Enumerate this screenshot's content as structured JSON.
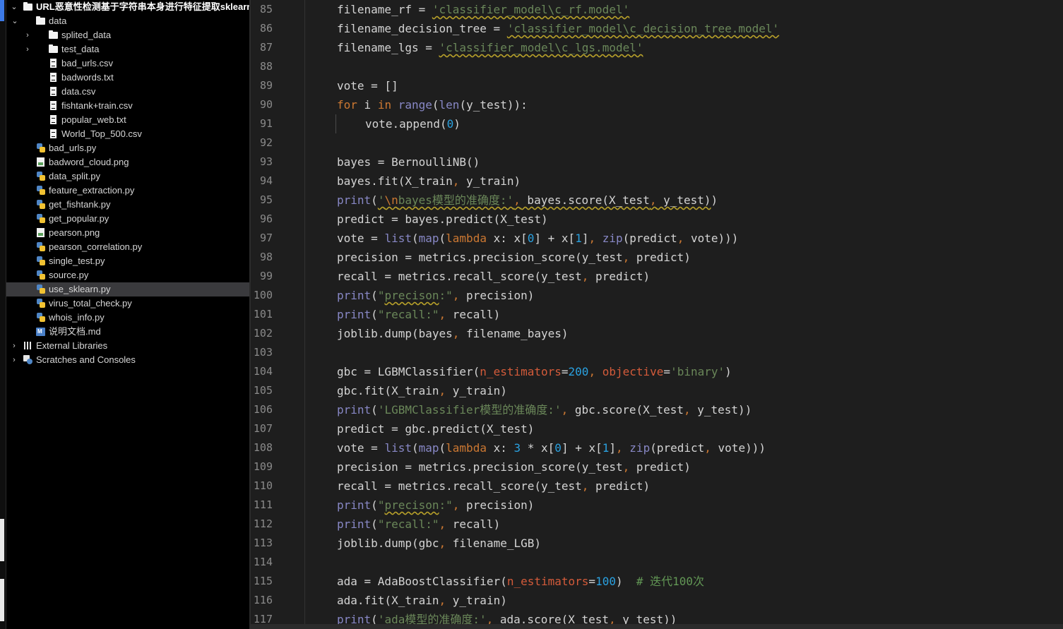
{
  "project_tree": {
    "root": "URL恶意性检测基于字符串本身进行特征提取sklearn库的",
    "items": [
      {
        "label": "data",
        "type": "folder",
        "depth": 1,
        "expanded": true
      },
      {
        "label": "splited_data",
        "type": "folder",
        "depth": 2,
        "expanded": false
      },
      {
        "label": "test_data",
        "type": "folder",
        "depth": 2,
        "expanded": false
      },
      {
        "label": "bad_urls.csv",
        "type": "file",
        "depth": 2
      },
      {
        "label": "badwords.txt",
        "type": "file",
        "depth": 2
      },
      {
        "label": "data.csv",
        "type": "file",
        "depth": 2
      },
      {
        "label": "fishtank+train.csv",
        "type": "file",
        "depth": 2
      },
      {
        "label": "popular_web.txt",
        "type": "file",
        "depth": 2
      },
      {
        "label": "World_Top_500.csv",
        "type": "file",
        "depth": 2
      },
      {
        "label": "bad_urls.py",
        "type": "python",
        "depth": 1
      },
      {
        "label": "badword_cloud.png",
        "type": "image",
        "depth": 1
      },
      {
        "label": "data_split.py",
        "type": "python",
        "depth": 1
      },
      {
        "label": "feature_extraction.py",
        "type": "python",
        "depth": 1
      },
      {
        "label": "get_fishtank.py",
        "type": "python",
        "depth": 1
      },
      {
        "label": "get_popular.py",
        "type": "python",
        "depth": 1
      },
      {
        "label": "pearson.png",
        "type": "image",
        "depth": 1
      },
      {
        "label": "pearson_correlation.py",
        "type": "python",
        "depth": 1
      },
      {
        "label": "single_test.py",
        "type": "python",
        "depth": 1
      },
      {
        "label": "source.py",
        "type": "python",
        "depth": 1
      },
      {
        "label": "use_sklearn.py",
        "type": "python",
        "depth": 1,
        "selected": true
      },
      {
        "label": "virus_total_check.py",
        "type": "python",
        "depth": 1
      },
      {
        "label": "whois_info.py",
        "type": "python",
        "depth": 1
      },
      {
        "label": "说明文档.md",
        "type": "markdown",
        "depth": 1
      }
    ],
    "external_libraries": "External Libraries",
    "scratches": "Scratches and Consoles"
  },
  "editor": {
    "lines": [
      {
        "n": "85",
        "t": [
          [
            "",
            "filename_rf = "
          ],
          [
            "s u",
            "'classifier_model\\c_rf.model'"
          ]
        ]
      },
      {
        "n": "86",
        "t": [
          [
            "",
            "filename_decision_tree = "
          ],
          [
            "s u",
            "'classifier_model\\c_decision_tree.model'"
          ]
        ]
      },
      {
        "n": "87",
        "t": [
          [
            "",
            "filename_lgs = "
          ],
          [
            "s u",
            "'classifier_model\\c_lgs.model'"
          ]
        ]
      },
      {
        "n": "88",
        "t": []
      },
      {
        "n": "89",
        "t": [
          [
            "",
            "vote = []"
          ]
        ]
      },
      {
        "n": "90",
        "t": [
          [
            "k",
            "for"
          ],
          [
            "",
            " i "
          ],
          [
            "k",
            "in"
          ],
          [
            "",
            " "
          ],
          [
            "b",
            "range"
          ],
          [
            "",
            "("
          ],
          [
            "b",
            "len"
          ],
          [
            "",
            "(y_test)):"
          ]
        ]
      },
      {
        "n": "91",
        "indent": true,
        "t": [
          [
            "",
            "vote.append("
          ],
          [
            "n",
            "0"
          ],
          [
            "",
            ")"
          ]
        ]
      },
      {
        "n": "92",
        "t": []
      },
      {
        "n": "93",
        "t": [
          [
            "",
            "bayes = BernoulliNB()"
          ]
        ]
      },
      {
        "n": "94",
        "t": [
          [
            "",
            "bayes.fit(X_train"
          ],
          [
            "e",
            ","
          ],
          [
            "",
            " y_train)"
          ]
        ]
      },
      {
        "n": "95",
        "t": [
          [
            "b",
            "print"
          ],
          [
            "",
            "("
          ],
          [
            "s u",
            "'"
          ],
          [
            "k u",
            "\\n"
          ],
          [
            "s u",
            "bayes模型的准确度:'"
          ],
          [
            "e u",
            ","
          ],
          [
            "u",
            " bayes.score(X_test"
          ],
          [
            "e u",
            ","
          ],
          [
            "u",
            " y_test)"
          ],
          [
            "",
            ")"
          ]
        ]
      },
      {
        "n": "96",
        "t": [
          [
            "",
            "predict = bayes.predict(X_test)"
          ]
        ]
      },
      {
        "n": "97",
        "t": [
          [
            "",
            "vote = "
          ],
          [
            "b",
            "list"
          ],
          [
            "",
            "("
          ],
          [
            "b",
            "map"
          ],
          [
            "",
            "("
          ],
          [
            "k",
            "lambda"
          ],
          [
            "",
            " x: x["
          ],
          [
            "n",
            "0"
          ],
          [
            "",
            "] + x["
          ],
          [
            "n",
            "1"
          ],
          [
            "",
            "]"
          ],
          [
            "e",
            ","
          ],
          [
            "",
            " "
          ],
          [
            "b",
            "zip"
          ],
          [
            "",
            "(predict"
          ],
          [
            "e",
            ","
          ],
          [
            "",
            " vote)))"
          ]
        ]
      },
      {
        "n": "98",
        "t": [
          [
            "",
            "precision = metrics.precision_score(y_test"
          ],
          [
            "e",
            ","
          ],
          [
            "",
            " predict)"
          ]
        ]
      },
      {
        "n": "99",
        "t": [
          [
            "",
            "recall = metrics.recall_score(y_test"
          ],
          [
            "e",
            ","
          ],
          [
            "",
            " predict)"
          ]
        ]
      },
      {
        "n": "100",
        "t": [
          [
            "b",
            "print"
          ],
          [
            "",
            "("
          ],
          [
            "s",
            "\""
          ],
          [
            "s u",
            "precison"
          ],
          [
            "s",
            ":\""
          ],
          [
            "e",
            ","
          ],
          [
            "",
            " precision)"
          ]
        ]
      },
      {
        "n": "101",
        "t": [
          [
            "b",
            "print"
          ],
          [
            "",
            "("
          ],
          [
            "s",
            "\"recall:\""
          ],
          [
            "e",
            ","
          ],
          [
            "",
            " recall)"
          ]
        ]
      },
      {
        "n": "102",
        "t": [
          [
            "",
            "joblib.dump(bayes"
          ],
          [
            "e",
            ","
          ],
          [
            "",
            " filename_bayes)"
          ]
        ]
      },
      {
        "n": "103",
        "t": []
      },
      {
        "n": "104",
        "t": [
          [
            "",
            "gbc = LGBMClassifier("
          ],
          [
            "p",
            "n_estimators"
          ],
          [
            "",
            "="
          ],
          [
            "n",
            "200"
          ],
          [
            "e",
            ","
          ],
          [
            "",
            " "
          ],
          [
            "p",
            "objective"
          ],
          [
            "",
            "="
          ],
          [
            "s",
            "'binary'"
          ],
          [
            "",
            ")"
          ]
        ]
      },
      {
        "n": "105",
        "t": [
          [
            "",
            "gbc.fit(X_train"
          ],
          [
            "e",
            ","
          ],
          [
            "",
            " y_train)"
          ]
        ]
      },
      {
        "n": "106",
        "t": [
          [
            "b",
            "print"
          ],
          [
            "",
            "("
          ],
          [
            "s",
            "'LGBMClassifier模型的准确度:'"
          ],
          [
            "e",
            ","
          ],
          [
            "",
            " gbc.score(X_test"
          ],
          [
            "e",
            ","
          ],
          [
            "",
            " y_test))"
          ]
        ]
      },
      {
        "n": "107",
        "t": [
          [
            "",
            "predict = gbc.predict(X_test)"
          ]
        ]
      },
      {
        "n": "108",
        "t": [
          [
            "",
            "vote = "
          ],
          [
            "b",
            "list"
          ],
          [
            "",
            "("
          ],
          [
            "b",
            "map"
          ],
          [
            "",
            "("
          ],
          [
            "k",
            "lambda"
          ],
          [
            "",
            " x: "
          ],
          [
            "n",
            "3"
          ],
          [
            "",
            " * x["
          ],
          [
            "n",
            "0"
          ],
          [
            "",
            "] + x["
          ],
          [
            "n",
            "1"
          ],
          [
            "",
            "]"
          ],
          [
            "e",
            ","
          ],
          [
            "",
            " "
          ],
          [
            "b",
            "zip"
          ],
          [
            "",
            "(predict"
          ],
          [
            "e",
            ","
          ],
          [
            "",
            " vote)))"
          ]
        ]
      },
      {
        "n": "109",
        "t": [
          [
            "",
            "precision = metrics.precision_score(y_test"
          ],
          [
            "e",
            ","
          ],
          [
            "",
            " predict)"
          ]
        ]
      },
      {
        "n": "110",
        "t": [
          [
            "",
            "recall = metrics.recall_score(y_test"
          ],
          [
            "e",
            ","
          ],
          [
            "",
            " predict)"
          ]
        ]
      },
      {
        "n": "111",
        "t": [
          [
            "b",
            "print"
          ],
          [
            "",
            "("
          ],
          [
            "s",
            "\""
          ],
          [
            "s u",
            "precison"
          ],
          [
            "s",
            ":\""
          ],
          [
            "e",
            ","
          ],
          [
            "",
            " precision)"
          ]
        ]
      },
      {
        "n": "112",
        "t": [
          [
            "b",
            "print"
          ],
          [
            "",
            "("
          ],
          [
            "s",
            "\"recall:\""
          ],
          [
            "e",
            ","
          ],
          [
            "",
            " recall)"
          ]
        ]
      },
      {
        "n": "113",
        "t": [
          [
            "",
            "joblib.dump(gbc"
          ],
          [
            "e",
            ","
          ],
          [
            "",
            " filename_LGB)"
          ]
        ]
      },
      {
        "n": "114",
        "t": []
      },
      {
        "n": "115",
        "t": [
          [
            "",
            "ada = AdaBoostClassifier("
          ],
          [
            "p",
            "n_estimators"
          ],
          [
            "",
            "="
          ],
          [
            "n",
            "100"
          ],
          [
            "",
            ")  "
          ],
          [
            "c",
            "# 迭代100次"
          ]
        ]
      },
      {
        "n": "116",
        "t": [
          [
            "",
            "ada.fit(X_train"
          ],
          [
            "e",
            ","
          ],
          [
            "",
            " y_train)"
          ]
        ]
      },
      {
        "n": "117",
        "t": [
          [
            "b",
            "print"
          ],
          [
            "",
            "("
          ],
          [
            "s",
            "'ada模型的准确度:'"
          ],
          [
            "e",
            ","
          ],
          [
            "",
            " ada.score(X_test"
          ],
          [
            "e",
            ","
          ],
          [
            "",
            " y_test))"
          ]
        ]
      }
    ]
  },
  "colors": {
    "tree_background": "#000000",
    "editor_background": "#1e1e1e",
    "keyword": "#cc7832",
    "builtin": "#8888c6",
    "string": "#6a8759",
    "number": "#2aa1e0",
    "param": "#d45b3a",
    "comment": "#629755",
    "selection": "#3a3a3d"
  }
}
